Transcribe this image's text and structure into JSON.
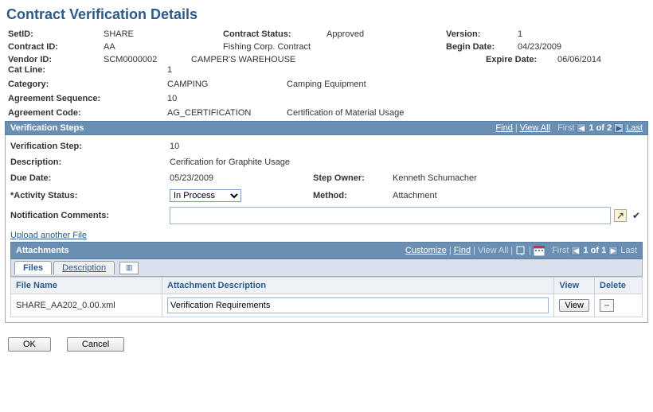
{
  "title": "Contract Verification Details",
  "header": {
    "setid_label": "SetID:",
    "setid": "SHARE",
    "contract_status_label": "Contract Status:",
    "contract_status": "Approved",
    "version_label": "Version:",
    "version": "1",
    "contract_id_label": "Contract ID:",
    "contract_id": "AA",
    "contract_name": "Fishing Corp. Contract",
    "begin_date_label": "Begin Date:",
    "begin_date": "04/23/2009",
    "vendor_id_label": "Vendor ID:",
    "vendor_id": "SCM0000002",
    "vendor_name": "CAMPER'S WAREHOUSE",
    "expire_date_label": "Expire Date:",
    "expire_date": "06/06/2014",
    "cat_line_label": "Cat Line:",
    "cat_line": "1",
    "category_label": "Category:",
    "category": "CAMPING",
    "category_desc": "Camping Equipment",
    "agreement_seq_label": "Agreement Sequence:",
    "agreement_seq": "10",
    "agreement_code_label": "Agreement Code:",
    "agreement_code": "AG_CERTIFICATION",
    "agreement_code_desc": "Certification of Material Usage"
  },
  "verification_steps": {
    "title": "Verification Steps",
    "nav": {
      "find": "Find",
      "view_all": "View All",
      "first": "First",
      "counter": "1 of 2",
      "last": "Last"
    },
    "step_label": "Verification Step:",
    "step": "10",
    "description_label": "Description:",
    "description": "Cerification for Graphite Usage",
    "due_date_label": "Due Date:",
    "due_date": "05/23/2009",
    "step_owner_label": "Step Owner:",
    "step_owner": "Kenneth Schumacher",
    "activity_status_label": "*Activity Status:",
    "activity_status": "In Process",
    "method_label": "Method:",
    "method": "Attachment",
    "notification_label": "Notification Comments:",
    "notification_value": ""
  },
  "upload_link": "Upload another File",
  "attachments": {
    "title": "Attachments",
    "nav": {
      "customize": "Customize",
      "find": "Find",
      "view_all": "View All",
      "first": "First",
      "counter": "1 of 1",
      "last": "Last"
    },
    "tabs": {
      "files": "Files",
      "description": "Description"
    },
    "columns": {
      "file_name": "File Name",
      "attachment_description": "Attachment Description",
      "view": "View",
      "delete": "Delete"
    },
    "rows": [
      {
        "file_name": "SHARE_AA202_0.00.xml",
        "description": "Verification Requirements",
        "view": "View"
      }
    ]
  },
  "footer": {
    "ok": "OK",
    "cancel": "Cancel"
  }
}
